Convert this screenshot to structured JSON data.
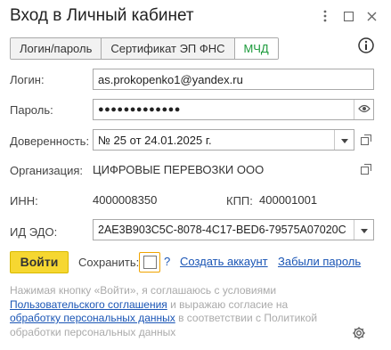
{
  "window": {
    "title": "Вход в Личный кабинет",
    "more_icon": "more-vertical-icon",
    "maximize_icon": "maximize-icon",
    "close_icon": "close-icon"
  },
  "tabs": [
    {
      "label": "Логин/пароль"
    },
    {
      "label": "Сертификат ЭП ФНС"
    },
    {
      "label": "МЧД"
    }
  ],
  "form": {
    "login_label": "Логин:",
    "login_value": "as.prokopenko1@yandex.ru",
    "password_label": "Пароль:",
    "password_value": "●●●●●●●●●●●●●",
    "proxy_label": "Доверенность:",
    "proxy_value": "№ 25 от 24.01.2025 г.",
    "org_label": "Организация:",
    "org_value": "ЦИФРОВЫЕ ПЕРЕВОЗКИ ООО",
    "inn_label": "ИНН:",
    "inn_value": "4000008350",
    "kpp_label": "КПП:",
    "kpp_value": "400001001",
    "edo_label": "ИД ЭДО:",
    "edo_value": "2AE3B903C5C-8078-4C17-BED6-79575A07020C"
  },
  "actions": {
    "login_button": "Войти",
    "save_label": "Сохранить:",
    "save_checked": false,
    "help": "?",
    "create_account": "Создать аккаунт",
    "forgot_password": "Забыли пароль"
  },
  "consent": {
    "part1": "Нажимая кнопку «Войти», я соглашаюсь с условиями",
    "link1": "Пользовательского соглашения",
    "part2": " и выражаю согласие на",
    "link2": "обработку персональных данных",
    "part3": " в соответствии с Политикой",
    "part4": "обработки персональных данных"
  },
  "colors": {
    "accent_active_tab": "#1a9a3a",
    "login_button": "#f6d731",
    "link": "#1a55b5",
    "focus_highlight": "#f0a400"
  }
}
